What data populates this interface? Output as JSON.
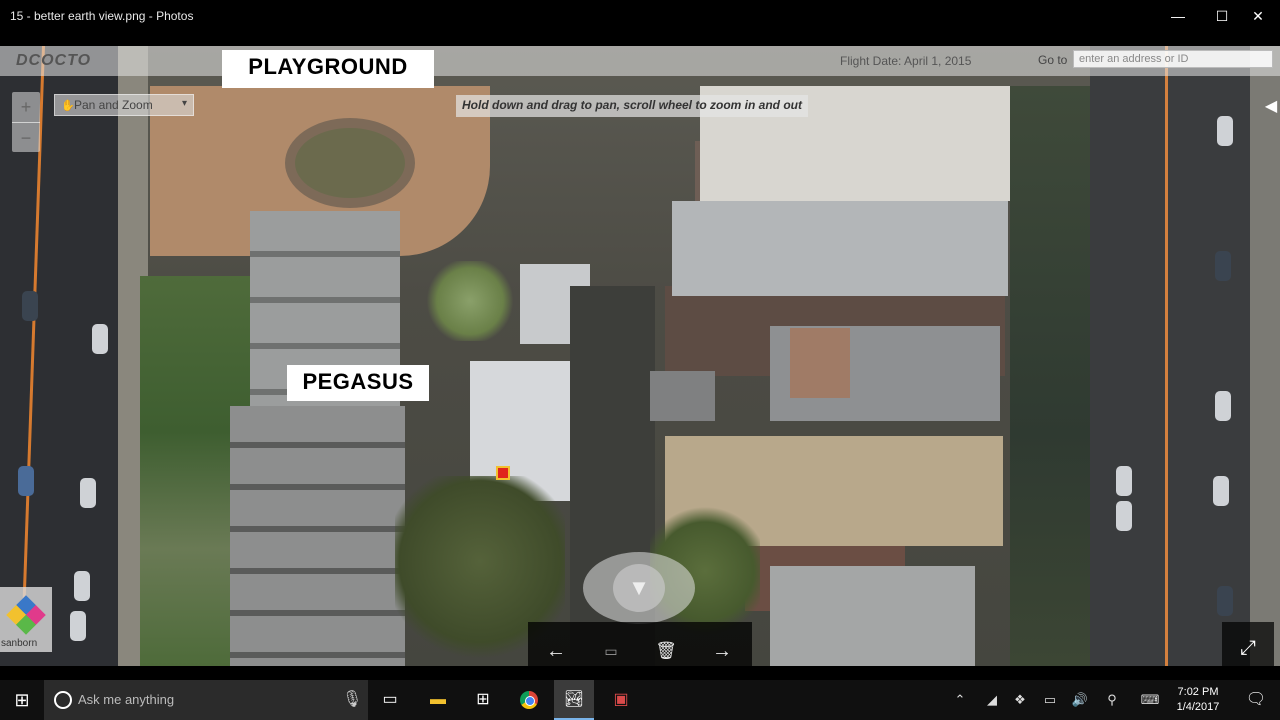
{
  "window": {
    "title": "15 - better earth view.png - Photos",
    "minimize_glyph": "—",
    "maximize_glyph": "☐",
    "close_glyph": "✕"
  },
  "map": {
    "brand": "DCOCTO",
    "flight_date": "Flight Date: April 1, 2015",
    "goto_label": "Go to",
    "goto_placeholder": "enter an address or ID",
    "zoom_in": "+",
    "zoom_out": "−",
    "mode_select": "Pan and Zoom",
    "hint": "Hold down and drag to pan, scroll wheel to zoom in and out",
    "labels": {
      "playground": "PLAYGROUND",
      "pegasus": "PEGASUS"
    },
    "logo_text": "sanborn",
    "icons": [
      "zoom-in-icon",
      "zoom-out-icon",
      "hand-icon",
      "compass-icon",
      "sanborn-logo",
      "marker-icon"
    ]
  },
  "photo_toolbar": {
    "back": "←",
    "slideshow": "▭",
    "delete": "🗑",
    "forward": "→",
    "fullscreen": "⤢"
  },
  "taskbar": {
    "search_placeholder": "Ask me anything",
    "clock_time": "7:02 PM",
    "clock_date": "1/4/2017",
    "apps": [
      "task-view",
      "file-explorer",
      "store",
      "chrome",
      "photos",
      "save-app"
    ],
    "tray_icons": [
      "chevron-up-icon",
      "network-icon",
      "dropbox-icon",
      "battery-icon",
      "volume-icon",
      "link-icon",
      "keyboard-icon"
    ]
  },
  "colors": {
    "marker": "#e0241c",
    "street_line": "#d67a2f",
    "taskbar": "#101010"
  }
}
